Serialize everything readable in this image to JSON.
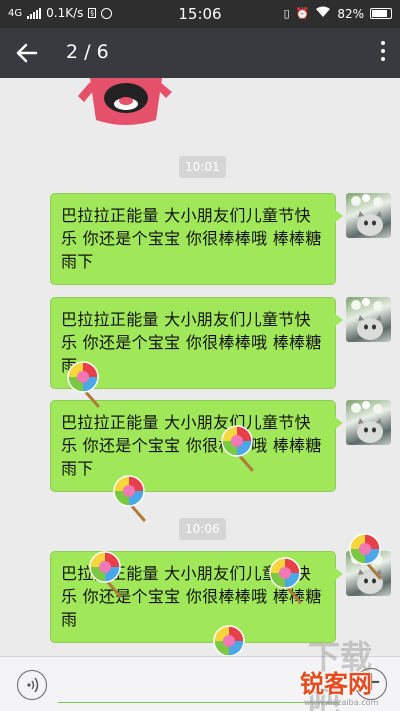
{
  "status_bar": {
    "network": "4G",
    "speed": "0.1K/s",
    "time": "15:06",
    "battery": "82%"
  },
  "header": {
    "page_indicator": "2 / 6"
  },
  "timestamps": [
    "10:01",
    "10:06"
  ],
  "messages": [
    {
      "text": "巴拉拉正能量 大小朋友们儿童节快乐 你还是个宝宝 你很棒棒哦 棒棒糖雨下"
    },
    {
      "text": "巴拉拉正能量 大小朋友们儿童节快乐 你还是个宝宝 你很棒棒哦 棒棒糖雨"
    },
    {
      "text": "巴拉拉正能量 大小朋友们儿童节快乐 你还是个宝宝 你很棒棒哦 棒棒糖雨下"
    },
    {
      "text": "巴拉拉正能量 大小朋友们儿童节快乐 你还是个宝宝 你很棒棒哦 棒棒糖雨"
    }
  ],
  "input_bar": {
    "placeholder": ""
  },
  "watermark": {
    "top": "下载吧",
    "main": "锐客网",
    "url": "www.xiazaiba.com"
  },
  "colors": {
    "bubble": "#a0e75a",
    "header": "#393a3f",
    "status_bar": "#2e2e2e",
    "chat_bg": "#ebebeb"
  }
}
